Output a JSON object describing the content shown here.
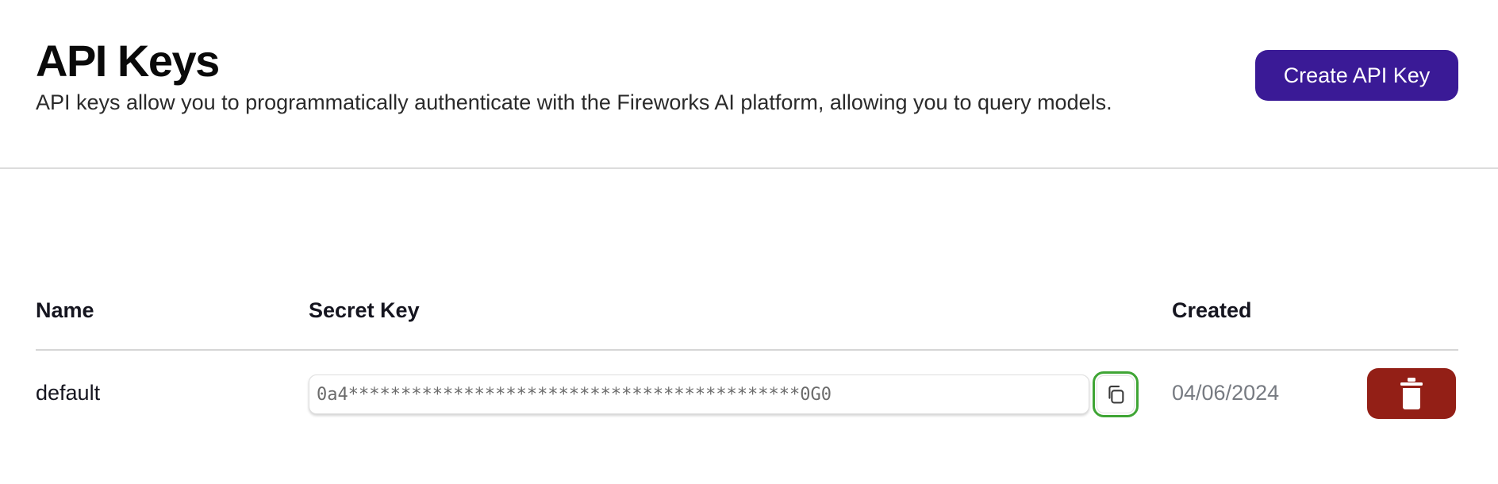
{
  "page": {
    "title": "API Keys",
    "description": "API keys allow you to programmatically authenticate with the Fireworks AI platform, allowing you to query models."
  },
  "actions": {
    "create_label": "Create API Key"
  },
  "table": {
    "columns": {
      "name": "Name",
      "secret_key": "Secret Key",
      "created": "Created"
    },
    "rows": [
      {
        "name": "default",
        "secret_key": "0a4*******************************************0G0",
        "created": "04/06/2024"
      }
    ]
  },
  "icons": {
    "copy": "copy-icon",
    "delete": "trash-icon"
  },
  "colors": {
    "primary_button": "#3a1a96",
    "delete_button": "#931f16",
    "copy_focus_ring": "#3fa535",
    "muted_text": "#777b82"
  }
}
